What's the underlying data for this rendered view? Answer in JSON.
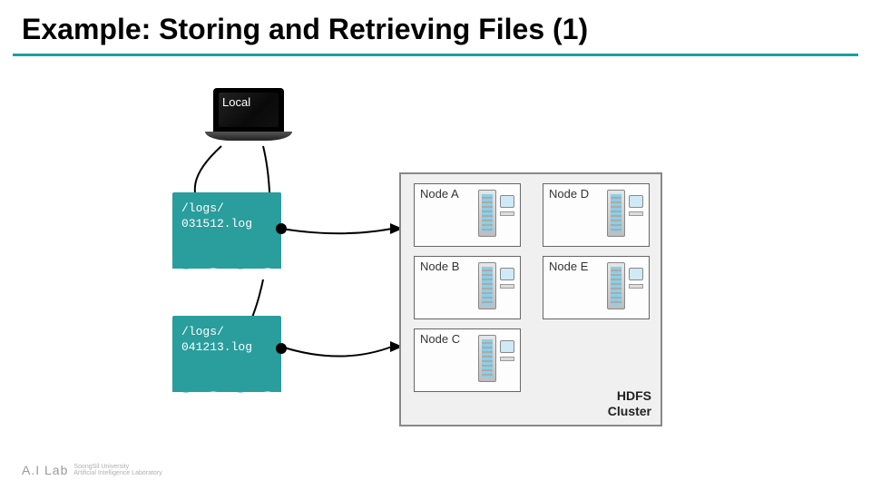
{
  "title": "Example: Storing and Retrieving Files (1)",
  "laptop": {
    "label": "Local"
  },
  "logs": {
    "a": {
      "line1": "/logs/",
      "line2": "031512.log"
    },
    "b": {
      "line1": "/logs/",
      "line2": "041213.log"
    }
  },
  "cluster": {
    "label_line1": "HDFS",
    "label_line2": "Cluster",
    "nodes": {
      "a": "Node A",
      "b": "Node B",
      "c": "Node C",
      "d": "Node D",
      "e": "Node E"
    }
  },
  "footer": {
    "brand": "A.I Lab",
    "line1": "SoongSil University",
    "line2": "Artificial Intelligence Laboratory"
  }
}
